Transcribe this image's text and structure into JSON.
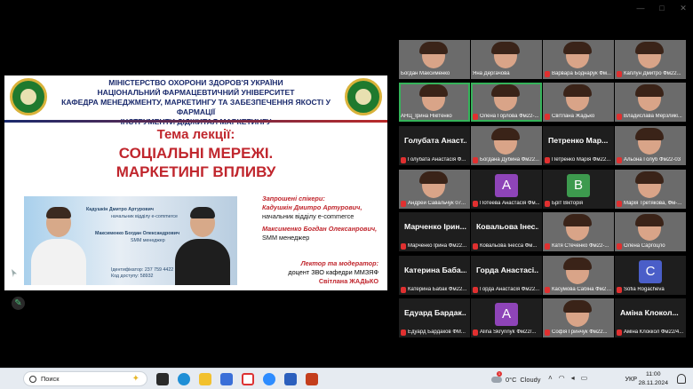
{
  "window": {
    "controls": [
      "—",
      "□",
      "✕"
    ]
  },
  "slide": {
    "header_lines": [
      "МІНІСТЕРСТВО ОХОРОНИ ЗДОРОВ'Я УКРАЇНИ",
      "НАЦІОНАЛЬНИЙ ФАРМАЦЕВТИЧНИЙ УНІВЕРСИТЕТ",
      "КАФЕДРА МЕНЕДЖМЕНТУ, МАРКЕТИНГУ ТА ЗАБЕЗПЕЧЕННЯ ЯКОСТІ У ФАРМАЦІЇ",
      "ІНСТРУМЕНТИ ДІДЖИТАЛ МАРКЕТИНГУ"
    ],
    "topic_label": "Тема лекції:",
    "topic_line1": "СОЦІАЛЬНІ МЕРЕЖІ.",
    "topic_line2": "МАРКЕТИНГ ВПЛИВУ",
    "panel": {
      "name1": "Кадушкін Дмитро Артурович",
      "role1": "начальник відділу e-commerce",
      "name2": "Максименко Богдан Олександрович",
      "role2": "SMM менеджер",
      "footer1": "Ідентифікатор: 237 759 4422",
      "footer2": "Код доступу: 58932"
    },
    "speakers_heading": "Запрошені спікери:",
    "speaker1_name": "Кадушкін Дмитро Артурович,",
    "speaker1_role": "начальник відділу e-commerce",
    "speaker2_name": "Максименко Богдан Олексанрович,",
    "speaker2_role": "SMM менеджер",
    "moderator_heading": "Лектор та модератор:",
    "moderator_role": "доцент ЗВО кафедри ММЗЯФ",
    "moderator_name": "Світлана ЖАДЬКО"
  },
  "participants": [
    {
      "label": "Богдан Максименко",
      "kind": "video",
      "muted": false
    },
    {
      "label": "Яна Дергачова",
      "kind": "video",
      "muted": false
    },
    {
      "label": "Варвара Боднарук Фм...",
      "kind": "video",
      "muted": true
    },
    {
      "label": "Каплун Дмитро Фм22...",
      "kind": "video",
      "muted": true
    },
    {
      "label": "АНЦ_Ірина Нікітенко",
      "kind": "video",
      "muted": false,
      "active": true
    },
    {
      "label": "Олена Горлова Фм22-...",
      "kind": "video",
      "muted": true,
      "active": true
    },
    {
      "label": "Світлана Жадько",
      "kind": "video",
      "muted": true
    },
    {
      "label": "Владислава Мерзликі...",
      "kind": "video",
      "muted": true
    },
    {
      "label": "Голубата Анастасія Ф...",
      "kind": "name",
      "big": "Голубата Анаст...",
      "muted": true
    },
    {
      "label": "Богдана Дубина Фм22...",
      "kind": "video",
      "muted": true
    },
    {
      "label": "Петренко Марія Фм22...",
      "kind": "name",
      "big": "Петренко Мар...",
      "muted": true
    },
    {
      "label": "Альона Голуб Фм22-03",
      "kind": "video",
      "muted": true
    },
    {
      "label": "Андрей Савальчук 07...",
      "kind": "video",
      "muted": true
    },
    {
      "label": "Потеева Анастасія Фм...",
      "kind": "avatar",
      "letter": "A",
      "color": "#8e44b8",
      "muted": true
    },
    {
      "label": "Бріт Вікторія",
      "kind": "avatar",
      "letter": "B",
      "color": "#3d9a4e",
      "muted": true
    },
    {
      "label": "Марія Третякова, Фм-...",
      "kind": "video",
      "muted": true
    },
    {
      "label": "Марченко Ірина Фм22...",
      "kind": "name",
      "big": "Марченко Ірин...",
      "muted": true
    },
    {
      "label": "Ковальова Інесса Фм...",
      "kind": "name",
      "big": "Ковальова Інес...",
      "muted": true
    },
    {
      "label": "Катя Стеченко Фм22-...",
      "kind": "video",
      "muted": true
    },
    {
      "label": "Олена Саргоцло",
      "kind": "video",
      "muted": true
    },
    {
      "label": "Катерина Бабак Фм22...",
      "kind": "name",
      "big": "Катерина Баба...",
      "muted": true
    },
    {
      "label": "Горда Анастасія Фм22...",
      "kind": "name",
      "big": "Горда Анастасі...",
      "muted": true
    },
    {
      "label": "Касумова Сабіна Фм22...",
      "kind": "video",
      "muted": true
    },
    {
      "label": "Sofia Rogacheva",
      "kind": "avatar",
      "letter": "C",
      "color": "#4a5ec8",
      "muted": true
    },
    {
      "label": "Едуард Бардаков ФМ...",
      "kind": "name",
      "big": "Едуард Бардак...",
      "muted": true
    },
    {
      "label": "Alina Skrynnyk Фм22/...",
      "kind": "avatar",
      "letter": "A",
      "color": "#8e44b8",
      "muted": true
    },
    {
      "label": "Софія Гринчук Фм22...",
      "kind": "video",
      "muted": true
    },
    {
      "label": "Аміна Клоккол Фм22/4...",
      "kind": "name",
      "big": "Аміна Клокол...",
      "muted": true
    }
  ],
  "taskbar": {
    "search_placeholder": "Поиск",
    "weather_temp": "0°C",
    "weather_text": "Cloudy",
    "weather_badge": "1",
    "language": "УКР",
    "time": "11:00",
    "date": "28.11.2024"
  }
}
